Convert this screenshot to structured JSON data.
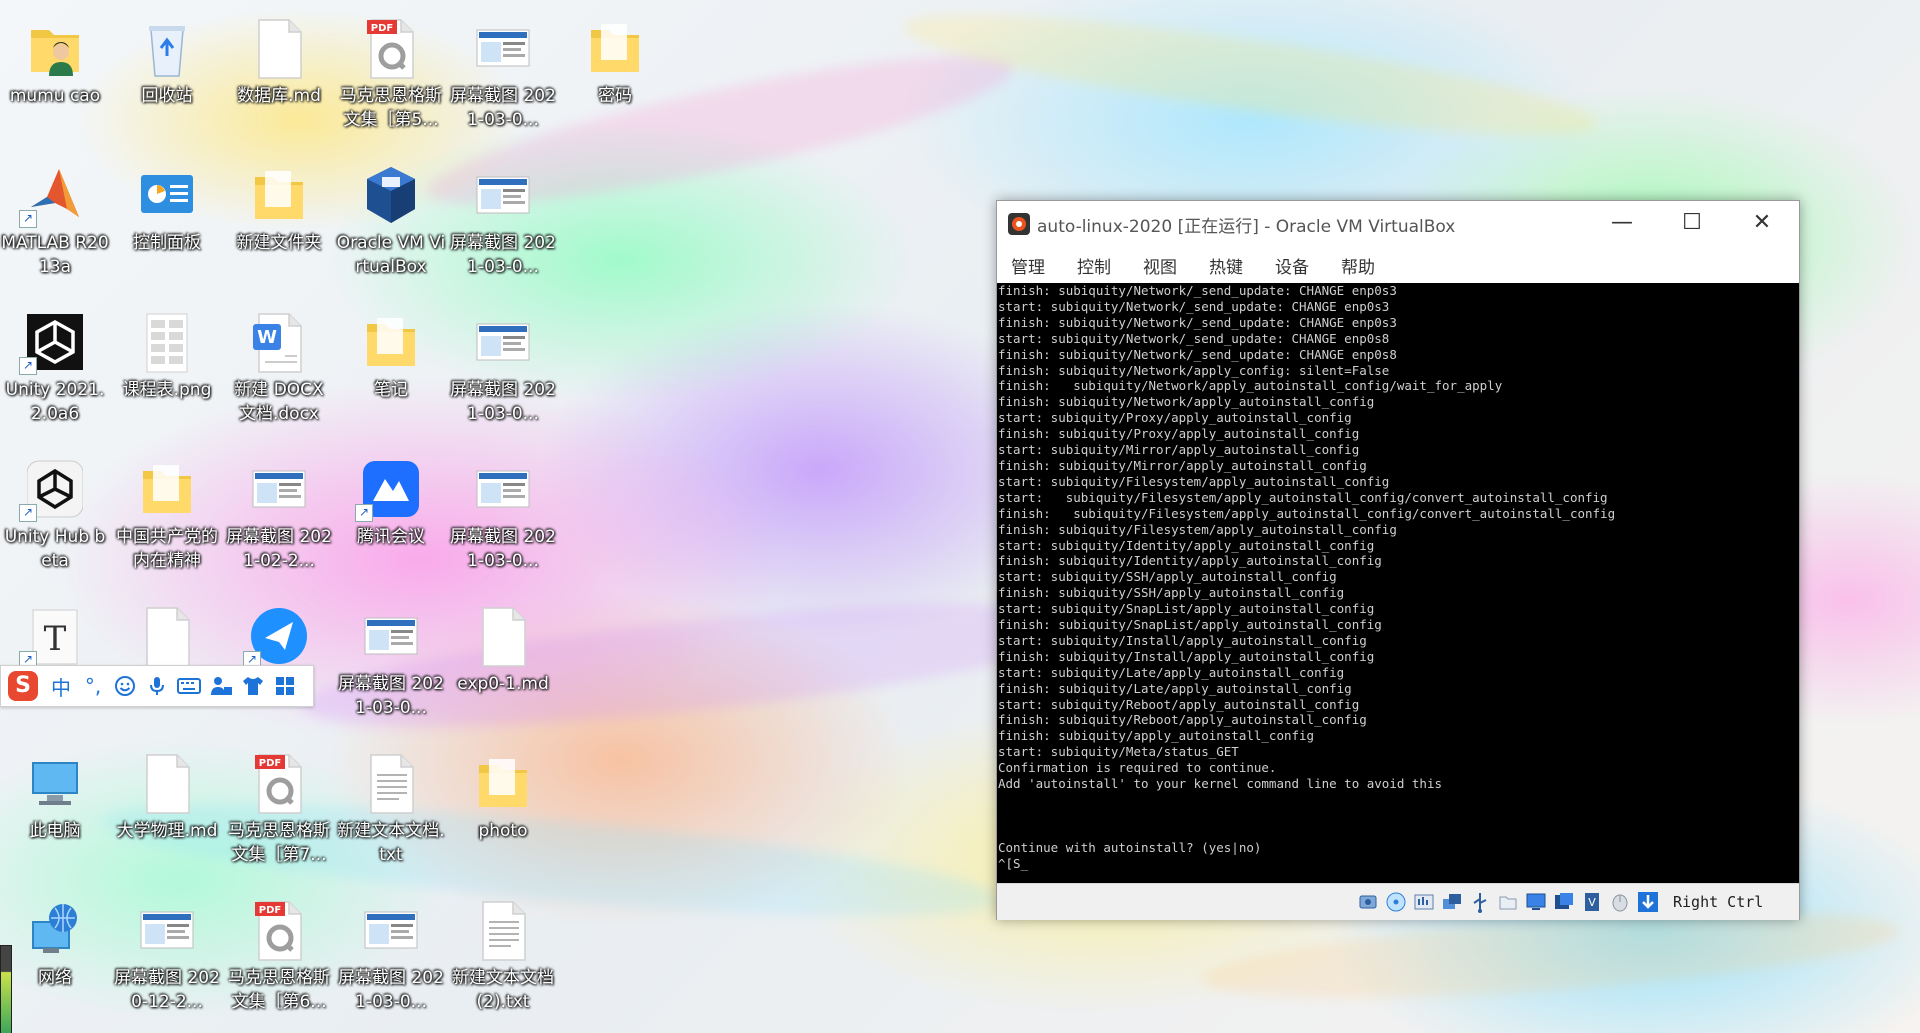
{
  "desktop": {
    "icons": [
      {
        "label": "mumu cao",
        "icon": "user-folder-icon"
      },
      {
        "label": "回收站",
        "icon": "recycle-bin-icon"
      },
      {
        "label": "数据库.md",
        "icon": "document-icon"
      },
      {
        "label": "马克思恩格斯文集［第5...",
        "icon": "pdf-icon",
        "badge": "PDF"
      },
      {
        "label": "屏幕截图 2021-03-0...",
        "icon": "screenshot-icon"
      },
      {
        "label": "密码",
        "icon": "folder-icon"
      },
      {
        "label": "MATLAB R2013a",
        "icon": "matlab-icon"
      },
      {
        "label": "控制面板",
        "icon": "control-panel-icon"
      },
      {
        "label": "新建文件夹",
        "icon": "folder-icon"
      },
      {
        "label": "Oracle VM VirtualBox",
        "icon": "virtualbox-icon"
      },
      {
        "label": "屏幕截图 2021-03-0...",
        "icon": "screenshot-icon"
      },
      {
        "label": "Unity 2021.2.0a6",
        "icon": "unity-icon"
      },
      {
        "label": "课程表.png",
        "icon": "image-icon"
      },
      {
        "label": "新建 DOCX 文档.docx",
        "icon": "word-doc-icon"
      },
      {
        "label": "笔记",
        "icon": "folder-icon"
      },
      {
        "label": "屏幕截图 2021-03-0...",
        "icon": "screenshot-icon"
      },
      {
        "label": "Unity Hub beta",
        "icon": "unity-hub-icon"
      },
      {
        "label": "中国共产党的内在精神",
        "icon": "folder-icon"
      },
      {
        "label": "屏幕截图 2021-02-2...",
        "icon": "screenshot-icon"
      },
      {
        "label": "腾讯会议",
        "icon": "tencent-meeting-icon"
      },
      {
        "label": "屏幕截图 2021-03-0...",
        "icon": "screenshot-icon"
      },
      {
        "label": "",
        "icon": "font-icon"
      },
      {
        "label": "",
        "icon": "document-icon"
      },
      {
        "label": "",
        "icon": "feishu-icon"
      },
      {
        "label": "屏幕截图 2021-03-0...",
        "icon": "screenshot-icon"
      },
      {
        "label": "exp0-1.md",
        "icon": "document-icon"
      },
      {
        "label": "此电脑",
        "icon": "this-pc-icon"
      },
      {
        "label": "大学物理.md",
        "icon": "document-icon"
      },
      {
        "label": "马克思恩格斯文集［第7...",
        "icon": "pdf-icon",
        "badge": "PDF"
      },
      {
        "label": "新建文本文档.txt",
        "icon": "text-file-icon"
      },
      {
        "label": "photo",
        "icon": "folder-icon"
      },
      {
        "label": "网络",
        "icon": "network-icon"
      },
      {
        "label": "屏幕截图 2020-12-2...",
        "icon": "screenshot-icon"
      },
      {
        "label": "马克思恩格斯文集［第6...",
        "icon": "pdf-icon",
        "badge": "PDF"
      },
      {
        "label": "屏幕截图 2021-03-0...",
        "icon": "screenshot-icon"
      },
      {
        "label": "新建文本文档 (2).txt",
        "icon": "text-file-icon"
      }
    ]
  },
  "ime": {
    "logo": "S",
    "mode": "中",
    "punct": "°,",
    "items": [
      "emoji-icon",
      "microphone-icon",
      "keyboard-icon",
      "user-tools-icon",
      "skin-shirt-icon",
      "grid-apps-icon"
    ]
  },
  "vbox": {
    "title": "auto-linux-2020 [正在运行] - Oracle VM VirtualBox",
    "menu": [
      "管理",
      "控制",
      "视图",
      "热键",
      "设备",
      "帮助"
    ],
    "console": [
      "finish: subiquity/Network/_send_update: CHANGE enp0s3",
      "start: subiquity/Network/_send_update: CHANGE enp0s3",
      "finish: subiquity/Network/_send_update: CHANGE enp0s3",
      "start: subiquity/Network/_send_update: CHANGE enp0s8",
      "finish: subiquity/Network/_send_update: CHANGE enp0s8",
      "finish: subiquity/Network/apply_config: silent=False",
      "finish:   subiquity/Network/apply_autoinstall_config/wait_for_apply",
      "finish: subiquity/Network/apply_autoinstall_config",
      "start: subiquity/Proxy/apply_autoinstall_config",
      "finish: subiquity/Proxy/apply_autoinstall_config",
      "start: subiquity/Mirror/apply_autoinstall_config",
      "finish: subiquity/Mirror/apply_autoinstall_config",
      "start: subiquity/Filesystem/apply_autoinstall_config",
      "start:   subiquity/Filesystem/apply_autoinstall_config/convert_autoinstall_config",
      "finish:   subiquity/Filesystem/apply_autoinstall_config/convert_autoinstall_config",
      "finish: subiquity/Filesystem/apply_autoinstall_config",
      "start: subiquity/Identity/apply_autoinstall_config",
      "finish: subiquity/Identity/apply_autoinstall_config",
      "start: subiquity/SSH/apply_autoinstall_config",
      "finish: subiquity/SSH/apply_autoinstall_config",
      "start: subiquity/SnapList/apply_autoinstall_config",
      "finish: subiquity/SnapList/apply_autoinstall_config",
      "start: subiquity/Install/apply_autoinstall_config",
      "finish: subiquity/Install/apply_autoinstall_config",
      "start: subiquity/Late/apply_autoinstall_config",
      "finish: subiquity/Late/apply_autoinstall_config",
      "start: subiquity/Reboot/apply_autoinstall_config",
      "finish: subiquity/Reboot/apply_autoinstall_config",
      "finish: subiquity/apply_autoinstall_config",
      "start: subiquity/Meta/status_GET",
      "Confirmation is required to continue.",
      "Add 'autoinstall' to your kernel command line to avoid this",
      "",
      "",
      "",
      "Continue with autoinstall? (yes|no)",
      "^[S_"
    ],
    "status_icons": [
      "hard-disk-icon",
      "optical-disk-icon",
      "audio-icon",
      "network-adapter-icon",
      "usb-icon",
      "shared-folder-icon",
      "display-icon",
      "recording-icon",
      "cpu-virtualization-icon",
      "mouse-integration-icon",
      "host-key-arrow-icon"
    ],
    "host_key": "Right Ctrl",
    "minimize": "—",
    "maximize": "☐",
    "close": "✕"
  }
}
